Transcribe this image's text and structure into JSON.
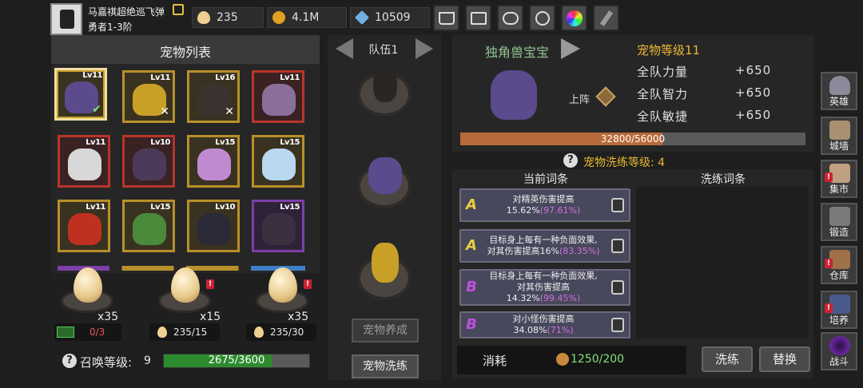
{
  "player": {
    "name": "马嘉祺超绝巡飞弹",
    "rank": "勇者1-3阶"
  },
  "resources": [
    {
      "icon": "egg-icon",
      "value": "235"
    },
    {
      "icon": "gold-coin-icon",
      "value": "4.1M"
    },
    {
      "icon": "gem-icon",
      "value": "10509"
    }
  ],
  "toolbar": [
    "cart-icon",
    "mail-icon",
    "gamepad-icon",
    "settings-gear-icon",
    "color-wheel-icon",
    "feather-icon"
  ],
  "pet_list": {
    "title": "宠物列表",
    "pets": [
      {
        "level": "Lv11",
        "status": "selected-deployed"
      },
      {
        "level": "Lv11",
        "status": "in-team"
      },
      {
        "level": "Lv16",
        "status": "in-team"
      },
      {
        "level": "Lv11",
        "status": ""
      },
      {
        "level": "Lv11",
        "status": ""
      },
      {
        "level": "Lv10",
        "status": ""
      },
      {
        "level": "Lv15",
        "status": ""
      },
      {
        "level": "Lv15",
        "status": ""
      },
      {
        "level": "Lv11",
        "status": ""
      },
      {
        "level": "Lv15",
        "status": ""
      },
      {
        "level": "Lv10",
        "status": ""
      },
      {
        "level": "Lv15",
        "status": ""
      }
    ]
  },
  "eggs": [
    {
      "count": "x35",
      "counter": "0/3",
      "counter_type": "ad"
    },
    {
      "count": "x15",
      "counter": "235/15",
      "counter_type": "egg"
    },
    {
      "count": "x35",
      "counter": "235/30",
      "counter_type": "egg"
    }
  ],
  "summon": {
    "label": "召唤等级:",
    "level": "9",
    "progress": "2675/3600",
    "progress_fraction": 0.743
  },
  "team": {
    "title": "队伍1",
    "raise_button": "宠物养成",
    "reroll_button": "宠物洗练"
  },
  "pet_detail": {
    "name": "独角兽宝宝",
    "pet_level": "宠物等级11",
    "deploy_label": "上阵",
    "stats": [
      {
        "label": "全队力量",
        "value": "+650"
      },
      {
        "label": "全队智力",
        "value": "+650"
      },
      {
        "label": "全队敏捷",
        "value": "+650"
      }
    ],
    "exp": "32800/56000",
    "exp_fraction": 0.586
  },
  "reroll": {
    "level_label": "宠物洗练等级: 4",
    "current_title": "当前词条",
    "new_title": "洗练词条",
    "affixes": [
      {
        "grade": "A",
        "line1": "对精英伤害提高",
        "line2": "15.62%",
        "pct": "(97.61%)"
      },
      {
        "grade": "A",
        "line1": "目标身上每有一种负面效果,",
        "line2": "对其伤害提高16%",
        "pct": "(83.35%)"
      },
      {
        "grade": "B",
        "line1": "目标身上每有一种负面效果,",
        "line2": "对其伤害提高",
        "line3": "14.32%",
        "pct": "(99.45%)"
      },
      {
        "grade": "B",
        "line1": "对小怪伤害提高",
        "line2": "34.08%",
        "pct": "(71%)"
      }
    ],
    "cost_label": "消耗",
    "cost_value": "1250/200",
    "reroll_button": "洗练",
    "replace_button": "替换"
  },
  "sidebar": [
    {
      "label": "英雄",
      "icon": "helmet-icon"
    },
    {
      "label": "城墙",
      "icon": "castle-wall-icon"
    },
    {
      "label": "集市",
      "icon": "market-icon"
    },
    {
      "label": "锻造",
      "icon": "anvil-icon"
    },
    {
      "label": "仓库",
      "icon": "warehouse-icon"
    },
    {
      "label": "培养",
      "icon": "training-icon"
    },
    {
      "label": "战斗",
      "icon": "portal-icon"
    }
  ]
}
